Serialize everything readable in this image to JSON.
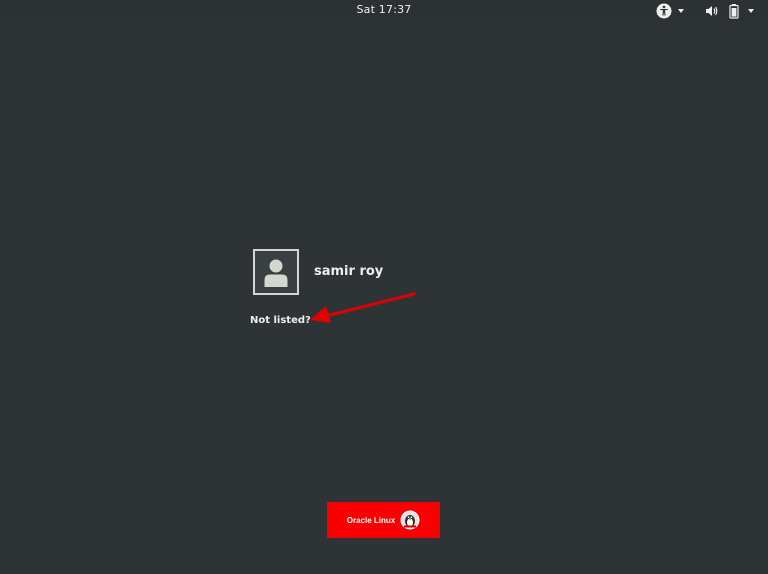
{
  "topbar": {
    "clock": "Sat 17:37",
    "icons": {
      "accessibility": "accessibility-icon",
      "volume": "volume-icon",
      "battery": "battery-icon",
      "menu_arrow": "chevron-down-icon"
    }
  },
  "login": {
    "user": {
      "name": "samir roy",
      "avatar_icon": "user-avatar-icon"
    },
    "not_listed_label": "Not listed?"
  },
  "branding": {
    "label": "Oracle Linux",
    "logo": "oracle-linux-penguin-logo",
    "color": "#f80000"
  },
  "annotation": {
    "arrow_color": "#e00000"
  },
  "colors": {
    "background": "#2e3436",
    "text": "#eeeeec"
  }
}
